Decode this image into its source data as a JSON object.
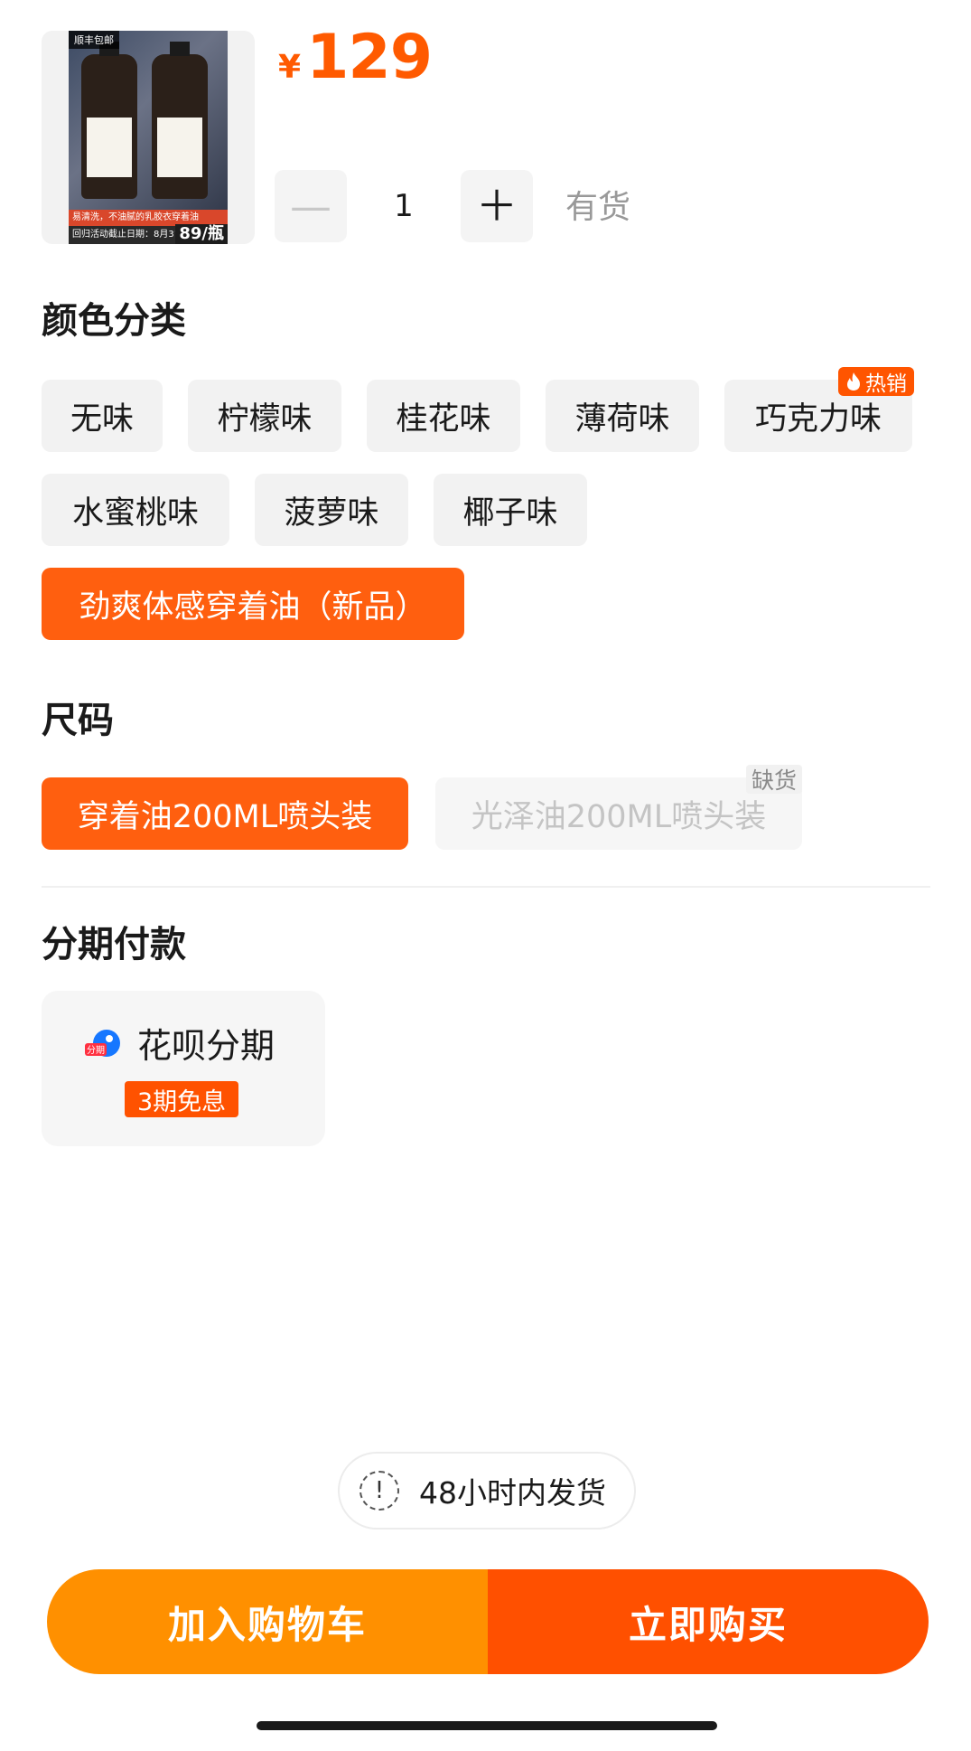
{
  "product": {
    "image_badge": "顺丰包邮",
    "image_promo": "易清洗，不油腻的乳胶衣穿着油",
    "image_date": "回归活动截止日期：8月31日",
    "image_price": "89/瓶",
    "currency": "¥",
    "price": "129"
  },
  "quantity": {
    "minus_icon": "minus-icon",
    "plus_icon": "plus-icon",
    "minus": "—",
    "plus": "＋",
    "value": "1",
    "stock": "有货"
  },
  "color_section": {
    "title": "颜色分类",
    "hot_tag": "热销",
    "options": [
      "无味",
      "柠檬味",
      "桂花味",
      "薄荷味",
      "巧克力味",
      "水蜜桃味",
      "菠萝味",
      "椰子味",
      "劲爽体感穿着油（新品）"
    ],
    "selected": "劲爽体感穿着油（新品）"
  },
  "size_section": {
    "title": "尺码",
    "options": [
      "穿着油200ML喷头装",
      "光泽油200ML喷头装"
    ],
    "selected": "穿着油200ML喷头装",
    "out_of_stock_tag": "缺货"
  },
  "installment": {
    "title": "分期付款",
    "icon_label": "分期",
    "label": "花呗分期",
    "badge": "3期免息"
  },
  "shipping": {
    "icon": "!",
    "text": "48小时内发货"
  },
  "actions": {
    "add_to_cart": "加入购物车",
    "buy_now": "立即购买"
  },
  "colors": {
    "accent": "#ff5a00",
    "cart_button": "#ff9000",
    "buy_button": "#ff5000"
  }
}
